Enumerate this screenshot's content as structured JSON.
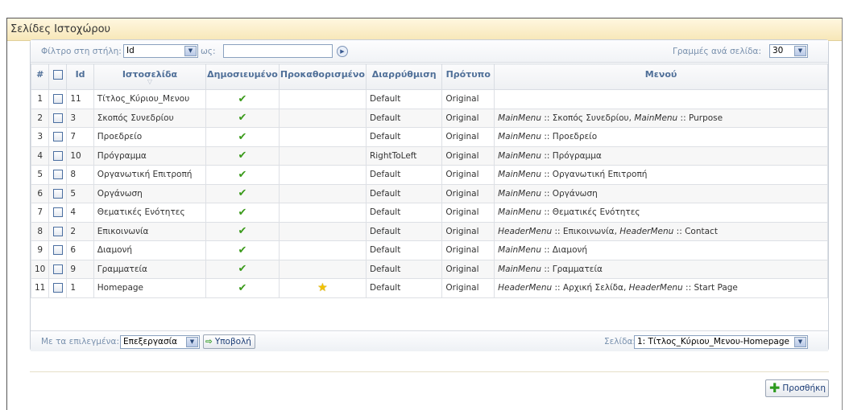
{
  "page": {
    "title": "Σελίδες Ιστοχώρου"
  },
  "filter": {
    "column_label": "Φίλτρο στη στήλη:",
    "column_value": "Id",
    "as_label": "ως:",
    "text_value": "",
    "rows_label": "Γραμμές ανά σελίδα:",
    "rows_value": "30"
  },
  "columns": {
    "num": "#",
    "id": "Id",
    "page": "Ιστοσελίδα",
    "published": "Δημοσιευμένο",
    "default": "Προκαθορισμένο",
    "layout": "Διαρρύθμιση",
    "template": "Πρότυπο",
    "menu": "Μενού"
  },
  "rows": [
    {
      "num": "1",
      "id": "11",
      "page": "Τίτλος_Κύριου_Μενου",
      "published": true,
      "is_default": false,
      "layout": "Default",
      "template": "Original",
      "menu": []
    },
    {
      "num": "2",
      "id": "3",
      "page": "Σκοπός Συνεδρίου",
      "published": true,
      "is_default": false,
      "layout": "Default",
      "template": "Original",
      "menu": [
        [
          "MainMenu",
          " :: Σκοπός Συνεδρίου, "
        ],
        [
          "MainMenu",
          " :: Purpose"
        ]
      ]
    },
    {
      "num": "3",
      "id": "7",
      "page": "Προεδρείο",
      "published": true,
      "is_default": false,
      "layout": "Default",
      "template": "Original",
      "menu": [
        [
          "MainMenu",
          " :: Προεδρείο"
        ]
      ]
    },
    {
      "num": "4",
      "id": "10",
      "page": "Πρόγραμμα",
      "published": true,
      "is_default": false,
      "layout": "RightToLeft",
      "template": "Original",
      "menu": [
        [
          "MainMenu",
          " :: Πρόγραμμα"
        ]
      ]
    },
    {
      "num": "5",
      "id": "8",
      "page": "Οργανωτική Επιτροπή",
      "published": true,
      "is_default": false,
      "layout": "Default",
      "template": "Original",
      "menu": [
        [
          "MainMenu",
          " :: Οργανωτική Επιτροπή"
        ]
      ]
    },
    {
      "num": "6",
      "id": "5",
      "page": "Οργάνωση",
      "published": true,
      "is_default": false,
      "layout": "Default",
      "template": "Original",
      "menu": [
        [
          "MainMenu",
          " :: Οργάνωση"
        ]
      ]
    },
    {
      "num": "7",
      "id": "4",
      "page": "Θεματικές Ενότητες",
      "published": true,
      "is_default": false,
      "layout": "Default",
      "template": "Original",
      "menu": [
        [
          "MainMenu",
          " :: Θεματικές Ενότητες"
        ]
      ]
    },
    {
      "num": "8",
      "id": "2",
      "page": "Επικοινωνία",
      "published": true,
      "is_default": false,
      "layout": "Default",
      "template": "Original",
      "menu": [
        [
          "HeaderMenu",
          " :: Επικοινωνία, "
        ],
        [
          "HeaderMenu",
          " :: Contact"
        ]
      ]
    },
    {
      "num": "9",
      "id": "6",
      "page": "Διαμονή",
      "published": true,
      "is_default": false,
      "layout": "Default",
      "template": "Original",
      "menu": [
        [
          "MainMenu",
          " :: Διαμονή"
        ]
      ]
    },
    {
      "num": "10",
      "id": "9",
      "page": "Γραμματεία",
      "published": true,
      "is_default": false,
      "layout": "Default",
      "template": "Original",
      "menu": [
        [
          "MainMenu",
          " :: Γραμματεία"
        ]
      ]
    },
    {
      "num": "11",
      "id": "1",
      "page": "Homepage",
      "published": true,
      "is_default": true,
      "layout": "Default",
      "template": "Original",
      "menu": [
        [
          "HeaderMenu",
          " :: Αρχική Σελίδα, "
        ],
        [
          "HeaderMenu",
          " :: Start Page"
        ]
      ]
    }
  ],
  "footer": {
    "selected_label": "Με τα επιλεγμένα:",
    "action_value": "Επεξεργασία",
    "submit_label": "Υποβολή",
    "page_label": "Σελίδα:",
    "page_value": "1: Τίτλος_Κύριου_Μενου-Homepage"
  },
  "add_label": "Προσθήκη",
  "colors": {
    "accent": "#4f6f98",
    "check": "#3a9a1a",
    "star": "#f2c200",
    "titlebar": "#f7e7b8"
  },
  "icons": {
    "published": "checkmark-icon",
    "default": "star-icon",
    "submit": "arrow-right-icon",
    "add": "plus-icon"
  }
}
